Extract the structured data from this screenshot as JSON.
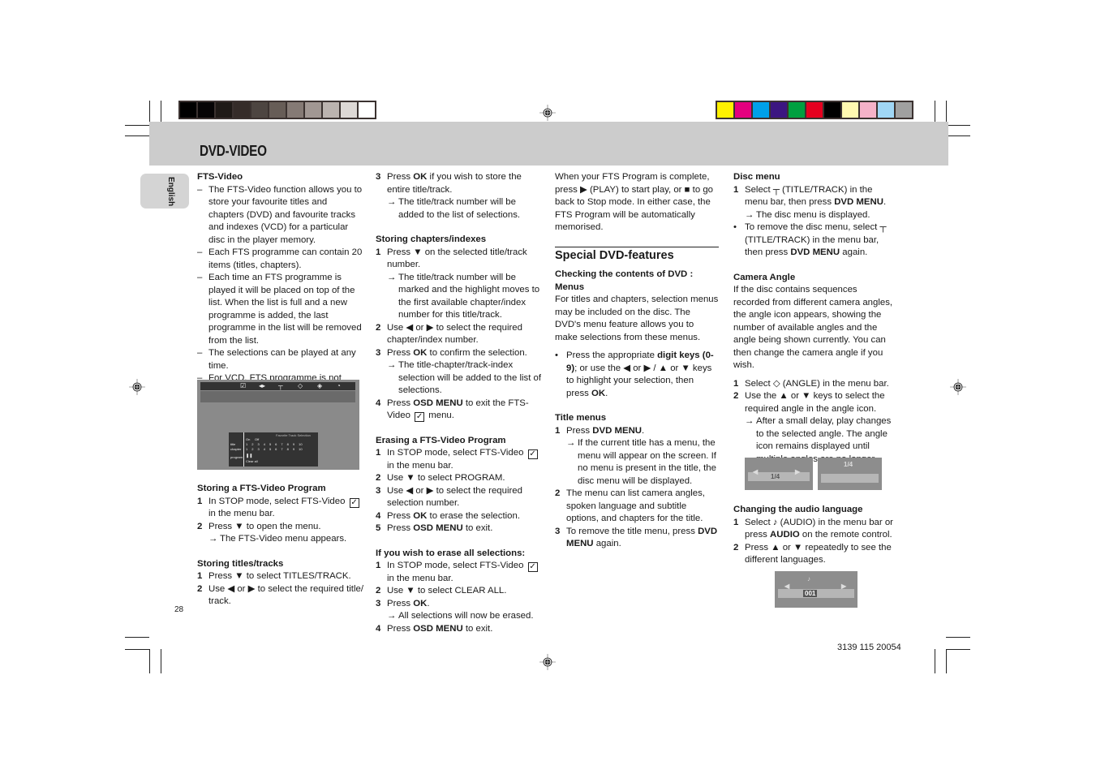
{
  "calibration": {
    "grayscale": [
      "#000000",
      "#060405",
      "#1f1a17",
      "#352c29",
      "#4d4541",
      "#675d57",
      "#857a75",
      "#a19793",
      "#bbb3af",
      "#ddd8d5",
      "#ffffff"
    ],
    "colors": [
      "#fff100",
      "#e4007f",
      "#00a0e9",
      "#3c1681",
      "#00a040",
      "#e5001f",
      "#000000",
      "#fff9b1",
      "#f5b2c8",
      "#a0d6f5",
      "#a0a0a0"
    ]
  },
  "header": {
    "title": "DVD-VIDEO",
    "language_tab": "English"
  },
  "page_number": "28",
  "doc_code": "3139 115 20054",
  "col1": {
    "fts_title": "FTS-Video",
    "fts_bullets": [
      "The FTS-Video function allows you to store your favourite titles and chapters (DVD) and favourite tracks and indexes (VCD) for a particular disc in the player memory.",
      "Each FTS programme can contain 20 items (titles, chapters).",
      "Each time an FTS programme is played it will be placed on top of the list. When the list is full and a new programme is added, the last programme in the list will be removed from the list.",
      "The selections can be played at any time.",
      "For VCD, FTS programme is not available whenever PBC mode is switched on."
    ],
    "screen": {
      "panel_title": "Favorite Track Selection",
      "on": "On",
      "off": "Off",
      "row_title": "title",
      "row_chapter": "chapter",
      "row_program": "program",
      "nums": [
        "1",
        "2",
        "3",
        "4",
        "5",
        "6",
        "7",
        "8",
        "9",
        "10"
      ],
      "clear": "Clear all"
    },
    "storing_program_title": "Storing a FTS-Video Program",
    "storing_program": {
      "s1a": "In STOP mode, select ",
      "s1b": "FTS-Video",
      "s1c": " in the menu bar.",
      "s2": "Press ▼ to open the menu.",
      "s2r_a": "The ",
      "s2r_b": "FTS-Video",
      "s2r_c": " menu appears."
    },
    "storing_titles_title": "Storing titles/tracks",
    "storing_titles": {
      "s1a": "Press ▼ to select ",
      "s1b": "TITLES/TRACK",
      "s1c": ".",
      "s2": "Use ◀ or ▶ to select the required title/ track."
    }
  },
  "col2": {
    "s3a": "Press ",
    "s3b": "OK",
    "s3c": " if you wish to store the entire title/track.",
    "s3r": "The title/track number will be added to the list of selections.",
    "chapters_title": "Storing chapters/indexes",
    "ch1": "Press ▼ on the selected title/track number.",
    "ch1r": "The title/track number will be marked and the highlight moves to the first available chapter/index number for this title/track.",
    "ch2": "Use ◀ or ▶ to select the required chapter/index number.",
    "ch3a": "Press ",
    "ch3b": "OK",
    "ch3c": " to confirm the selection.",
    "ch3r": "The title-chapter/track-index selection will be added to the list of selections.",
    "ch4a": "Press ",
    "ch4b": "OSD MENU",
    "ch4c": " to exit the FTS-Video",
    "ch4d": " menu.",
    "erasing_title": "Erasing a FTS-Video Program",
    "er1a": "In STOP mode, select ",
    "er1b": "FTS-Video",
    "er1c": " in the menu bar.",
    "er2a": "Use ▼ to select ",
    "er2b": "PROGRAM",
    "er2c": ".",
    "er3": "Use ◀ or ▶ to select the required selection number.",
    "er4a": "Press ",
    "er4b": "OK",
    "er4c": " to erase the selection.",
    "er5a": "Press ",
    "er5b": "OSD MENU",
    "er5c": " to exit.",
    "eraseall_title": "If you wish to erase all selections:",
    "ea1a": "In STOP mode, select ",
    "ea1b": "FTS-Video",
    "ea1c": " in the menu bar.",
    "ea2a": "Use ▼ to select ",
    "ea2b": "CLEAR ALL",
    "ea2c": ".",
    "ea3a": "Press ",
    "ea3b": "OK",
    "ea3c": ".",
    "ea3r": "All selections will now be erased.",
    "ea4a": "Press ",
    "ea4b": "OSD MENU",
    "ea4c": " to exit."
  },
  "col3": {
    "intro": "When your FTS Program is complete, press ▶ (PLAY) to start play, or ■ to go back to Stop mode. In either case, the FTS Program will be automatically memorised.",
    "special_title": "Special DVD-features",
    "checking_title": "Checking the contents of DVD : Menus",
    "checking_text": "For titles and chapters, selection menus may be included on the disc. The DVD's menu feature allows you to make selections from these menus.",
    "bullet_a": "Press the appropriate ",
    "bullet_b": "digit keys (0-9)",
    "bullet_c": "; or use the ◀ or ▶ / ▲ or ▼ keys to highlight your selection, then press ",
    "bullet_d": "OK",
    "bullet_e": ".",
    "title_menus_title": "Title menus",
    "tm1a": "Press ",
    "tm1b": "DVD MENU",
    "tm1c": ".",
    "tm1r": "If the current title has a menu, the menu will appear on the screen. If no menu is present in the title, the disc menu will be displayed.",
    "tm2": "The menu can list camera angles, spoken language and subtitle options, and chapters for the title.",
    "tm3a": "To remove the title menu, press ",
    "tm3b": "DVD MENU",
    "tm3c": " again."
  },
  "col4": {
    "disc_title": "Disc menu",
    "d1a": "Select ┬ (TITLE/TRACK) in the menu bar, then press ",
    "d1b": "DVD MENU",
    "d1c": ".",
    "d1r": "The disc menu is displayed.",
    "dba": "To remove the disc menu, select ┬ (TITLE/TRACK) in the menu bar, then press ",
    "dbb": "DVD MENU",
    "dbc": " again.",
    "angle_title": "Camera Angle",
    "angle_text": "If the disc contains sequences recorded from different camera angles, the angle icon appears, showing the number of available angles and the angle being shown currently. You can then change the camera angle if you wish.",
    "a1": "Select ◇ (ANGLE) in the menu bar.",
    "a2": "Use the ▲ or ▼ keys to select the required angle in the angle icon.",
    "a2r": "After a small delay, play changes to the selected angle. The angle icon remains displayed until multiple angles are no longer available.",
    "angle_osd1": "1/4",
    "angle_osd2": "1/4",
    "audio_title": "Changing the audio language",
    "au1a": "Select ♪ (AUDIO) in the menu bar or press ",
    "au1b": "AUDIO",
    "au1c": " on the remote control.",
    "au2": "Press ▲ or ▼ repeatedly to see the different languages.",
    "audio_osd": "001"
  },
  "glyphs": {
    "dash": "–",
    "arrow": "→",
    "bullet": "•",
    "check": "✓"
  }
}
